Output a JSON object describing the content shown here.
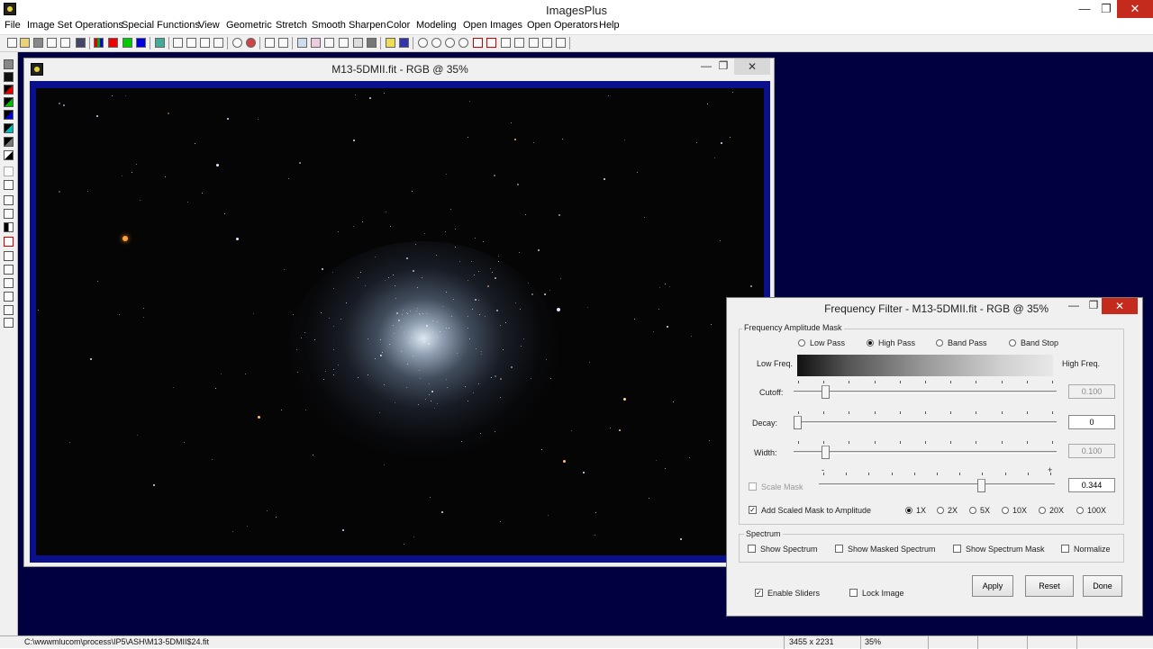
{
  "app": {
    "title": "ImagesPlus"
  },
  "window_controls": {
    "minimize": "—",
    "maximize": "❐",
    "close": "✕"
  },
  "menu": [
    "File",
    "Image Set Operations",
    "Special Functions",
    "View",
    "Geometric",
    "Stretch",
    "Smooth Sharpen",
    "Color",
    "Modeling",
    "Open Images",
    "Open Operators",
    "Help"
  ],
  "image_window": {
    "title": "M13-5DMII.fit - RGB @ 35%"
  },
  "dialog": {
    "title": "Frequency Filter - M13-5DMII.fit - RGB @ 35%",
    "mask_group_label": "Frequency Amplitude Mask",
    "filter_types": [
      {
        "label": "Low Pass",
        "selected": false
      },
      {
        "label": "High Pass",
        "selected": true
      },
      {
        "label": "Band Pass",
        "selected": false
      },
      {
        "label": "Band Stop",
        "selected": false
      }
    ],
    "low_freq_label": "Low Freq.",
    "high_freq_label": "High Freq.",
    "cutoff": {
      "label": "Cutoff:",
      "value": "0.100",
      "position": 0.11,
      "enabled": false
    },
    "decay": {
      "label": "Decay:",
      "value": "0",
      "position": 0.0,
      "enabled": true
    },
    "width": {
      "label": "Width:",
      "value": "0.100",
      "position": 0.11,
      "enabled": false
    },
    "scale_mask": {
      "label": "Scale Mask",
      "value": "0.344",
      "position": 0.7,
      "checked": false,
      "enabled": false,
      "min_mark": "-",
      "max_mark": "+"
    },
    "add_scaled": {
      "label": "Add Scaled Mask to Amplitude",
      "checked": true
    },
    "multipliers": [
      {
        "label": "1X",
        "selected": true
      },
      {
        "label": "2X",
        "selected": false
      },
      {
        "label": "5X",
        "selected": false
      },
      {
        "label": "10X",
        "selected": false
      },
      {
        "label": "20X",
        "selected": false
      },
      {
        "label": "100X",
        "selected": false
      }
    ],
    "spectrum_group_label": "Spectrum",
    "spectrum_options": [
      {
        "label": "Show Spectrum",
        "checked": false
      },
      {
        "label": "Show Masked Spectrum",
        "checked": false
      },
      {
        "label": "Show Spectrum Mask",
        "checked": false
      },
      {
        "label": "Normalize",
        "checked": false
      }
    ],
    "enable_sliders": {
      "label": "Enable Sliders",
      "checked": true
    },
    "lock_image": {
      "label": "Lock Image",
      "checked": false
    },
    "buttons": {
      "apply": "Apply",
      "reset": "Reset",
      "done": "Done"
    }
  },
  "status": {
    "path": "C:\\wwwmlucom\\process\\IP5\\ASH\\M13-5DMII$24.fit",
    "dimensions": "3455 x 2231",
    "zoom": "35%"
  }
}
